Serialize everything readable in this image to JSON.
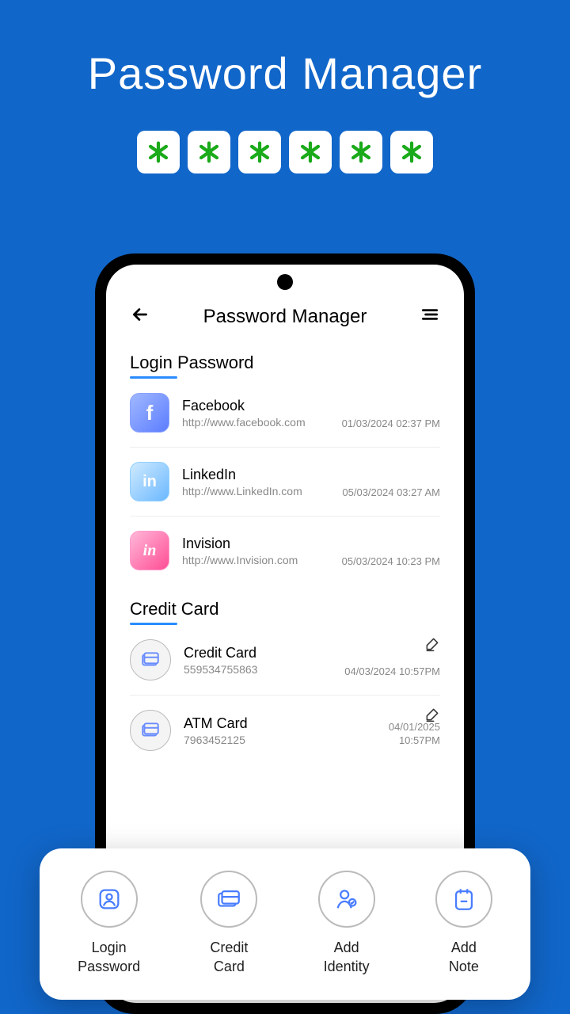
{
  "hero": {
    "title": "Password Manager",
    "dot_count": 6
  },
  "app": {
    "title": "Password Manager",
    "sections": {
      "login": {
        "title": "Login Password",
        "items": [
          {
            "name": "Facebook",
            "url": "http://www.facebook.com",
            "ts": "01/03/2024 02:37 PM",
            "icon": "fb"
          },
          {
            "name": "LinkedIn",
            "url": "http://www.LinkedIn.com",
            "ts": "05/03/2024 03:27 AM",
            "icon": "li"
          },
          {
            "name": "Invision",
            "url": "http://www.Invision.com",
            "ts": "05/03/2024 10:23 PM",
            "icon": "inv"
          }
        ]
      },
      "card": {
        "title": "Credit Card",
        "items": [
          {
            "name": "Credit Card",
            "number": "559534755863",
            "ts": "04/03/2024 10:57PM"
          },
          {
            "name": "ATM Card",
            "number": "7963452125",
            "ts1": "04/01/2025",
            "ts2": "10:57PM"
          }
        ]
      }
    }
  },
  "sheet": {
    "items": [
      {
        "line1": "Login",
        "line2": "Password",
        "icon": "login"
      },
      {
        "line1": "Credit",
        "line2": "Card",
        "icon": "card"
      },
      {
        "line1": "Add",
        "line2": "Identity",
        "icon": "identity"
      },
      {
        "line1": "Add",
        "line2": "Note",
        "icon": "note"
      }
    ]
  }
}
